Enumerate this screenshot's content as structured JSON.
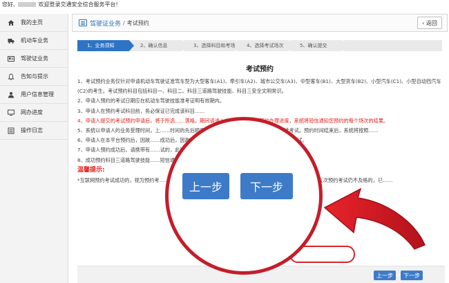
{
  "topbar": {
    "greeting": "您好,",
    "welcome": "欢迎登录交通安全综合服务平台!"
  },
  "sidebar": {
    "items": [
      {
        "label": "我的主页",
        "icon": "home-icon"
      },
      {
        "label": "机动车业务",
        "icon": "truck-icon"
      },
      {
        "label": "驾驶证业务",
        "icon": "id-card-icon"
      },
      {
        "label": "告知与提示",
        "icon": "bell-icon"
      },
      {
        "label": "用户信息管理",
        "icon": "user-icon"
      },
      {
        "label": "网办进度",
        "icon": "computer-icon"
      },
      {
        "label": "操作日志",
        "icon": "list-icon"
      }
    ]
  },
  "header": {
    "breadcrumb_main": "驾驶证业务",
    "breadcrumb_sep": "/",
    "breadcrumb_sub": "考试预约",
    "back_label": "‹ 返回"
  },
  "steps": [
    {
      "label": "1、业务须知",
      "active": true
    },
    {
      "label": "2、确认信息",
      "active": false
    },
    {
      "label": "3、选择科目和考场",
      "active": false
    },
    {
      "label": "4、选择考试场次",
      "active": false
    },
    {
      "label": "5、确认提交",
      "active": false
    }
  ],
  "page_title": "考试预约",
  "paragraphs": [
    {
      "text": "1、考试预约业务仅针对申请机动车驾驶证准驾车型为大型客车(A1)、牵引车(A2)、城市公交车(A3)、中型客车(B1)、大型货车(B2)、小型汽车(C1)、小型自动挡汽车(C2)的考生。考试预约科目包括科目一、科目二、科目三道路驾驶技能、科目三安全文明常识。",
      "red": false
    },
    {
      "text": "2、申请人预约的考试日期应在机动车驾驶技能准考证明有效期内。",
      "red": false
    },
    {
      "text": "3、申请人在预约考试科目前，务必保证已完成该科目……",
      "red": false
    },
    {
      "text": "4、申请人提交的考试预约申请后，将于所选……落格。期间请进入本业务入口查阅预约办理进度，系统将短信通知您预约的每个场次的结果。",
      "red": true
    },
    {
      "text": "5、系统以申请人的业务受理时间，上……时间的先后顺序作为排序规则，排名在前面的优先安排考试。预约时间结束后，系统将按照……",
      "red": false
    },
    {
      "text": "6、申请人在本平台预约后，因故……成功后，因故无法参加考试的，请至少提前1天到车管所取消考试。",
      "red": false
    },
    {
      "text": "7、申请人预约成功后，请携带有……试的，此次考试成绩将会判定为不及格。",
      "red": false
    },
    {
      "text": "8、成功预约科目三道路驾驶技能……短信通……注意查收信息并提前做好安排。",
      "red": false
    }
  ],
  "warm_tip": {
    "title": "温馨提示:",
    "text": "*互联网预约考试成功的，视为预约考……或者科目二和科目三道路驾驶技能考试预约考试的次数超过五次且第五次预约考试仍不及格的，已……"
  },
  "buttons": {
    "prev_label": "上一步",
    "next_label": "下一步"
  },
  "colors": {
    "accent": "#2e74c4",
    "highlight_ring": "#c41e2a",
    "warning_text": "#e0201a"
  }
}
